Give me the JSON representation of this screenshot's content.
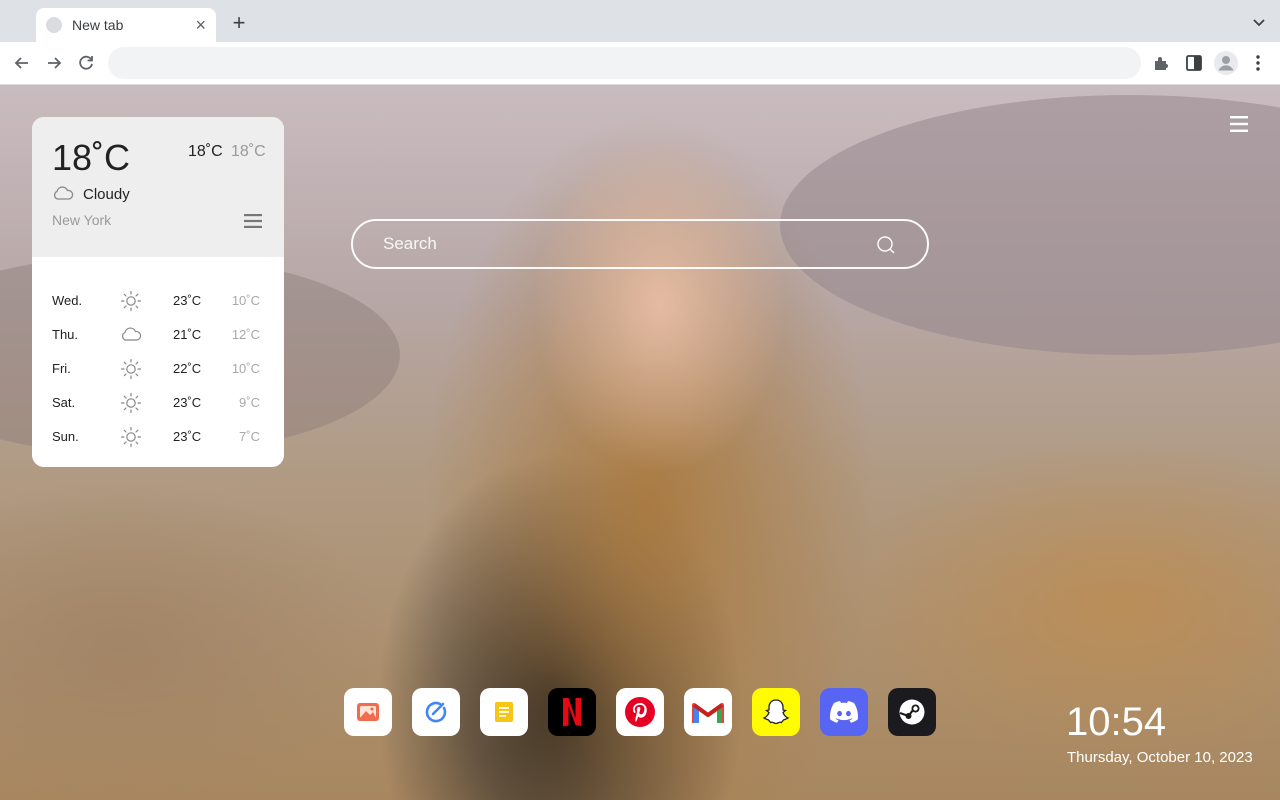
{
  "browser": {
    "tab_title": "New tab",
    "tab_close": "×",
    "new_tab": "+",
    "omnibox_value": ""
  },
  "weather": {
    "current_temp": "18˚C",
    "today_high": "18˚C",
    "today_low": "18˚C",
    "condition": "Cloudy",
    "condition_icon": "cloud-icon",
    "city": "New York",
    "forecast": [
      {
        "day": "Wed.",
        "icon": "sun-icon",
        "high": "23˚C",
        "low": "10˚C"
      },
      {
        "day": "Thu.",
        "icon": "cloud-icon",
        "high": "21˚C",
        "low": "12˚C"
      },
      {
        "day": "Fri.",
        "icon": "sun-icon",
        "high": "22˚C",
        "low": "10˚C"
      },
      {
        "day": "Sat.",
        "icon": "sun-icon",
        "high": "23˚C",
        "low": "9˚C"
      },
      {
        "day": "Sun.",
        "icon": "sun-icon",
        "high": "23˚C",
        "low": "7˚C"
      }
    ]
  },
  "search": {
    "placeholder": "Search"
  },
  "dock": {
    "apps": [
      {
        "name": "gallery-app-icon",
        "bg": "#ffffff"
      },
      {
        "name": "tasks-app-icon",
        "bg": "#ffffff"
      },
      {
        "name": "notes-app-icon",
        "bg": "#ffffff"
      },
      {
        "name": "netflix-app-icon",
        "bg": "#000000"
      },
      {
        "name": "pinterest-app-icon",
        "bg": "#ffffff"
      },
      {
        "name": "gmail-app-icon",
        "bg": "#ffffff"
      },
      {
        "name": "snapchat-app-icon",
        "bg": "#fffc00"
      },
      {
        "name": "discord-app-icon",
        "bg": "#5865f2"
      },
      {
        "name": "steam-app-icon",
        "bg": "#1b1b1f"
      }
    ]
  },
  "clock": {
    "time": "10:54",
    "date": "Thursday, October 10, 2023"
  },
  "colors": {
    "netflix": "#e50914",
    "pinterest": "#e60023",
    "gmail_red": "#ea4335",
    "notes_yellow": "#f5c518",
    "tasks_blue": "#4285f4"
  }
}
